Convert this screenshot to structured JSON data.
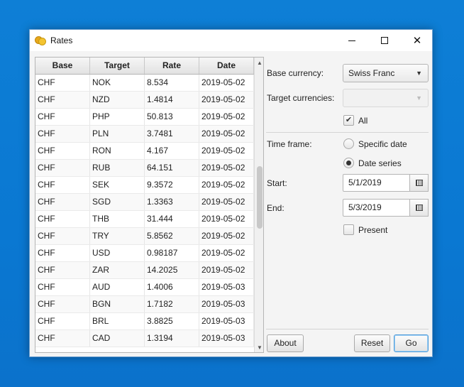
{
  "window": {
    "title": "Rates",
    "icon": "coins-icon"
  },
  "table": {
    "headers": [
      "Base",
      "Target",
      "Rate",
      "Date"
    ],
    "rows": [
      [
        "CHF",
        "NOK",
        "8.534",
        "2019-05-02"
      ],
      [
        "CHF",
        "NZD",
        "1.4814",
        "2019-05-02"
      ],
      [
        "CHF",
        "PHP",
        "50.813",
        "2019-05-02"
      ],
      [
        "CHF",
        "PLN",
        "3.7481",
        "2019-05-02"
      ],
      [
        "CHF",
        "RON",
        "4.167",
        "2019-05-02"
      ],
      [
        "CHF",
        "RUB",
        "64.151",
        "2019-05-02"
      ],
      [
        "CHF",
        "SEK",
        "9.3572",
        "2019-05-02"
      ],
      [
        "CHF",
        "SGD",
        "1.3363",
        "2019-05-02"
      ],
      [
        "CHF",
        "THB",
        "31.444",
        "2019-05-02"
      ],
      [
        "CHF",
        "TRY",
        "5.8562",
        "2019-05-02"
      ],
      [
        "CHF",
        "USD",
        "0.98187",
        "2019-05-02"
      ],
      [
        "CHF",
        "ZAR",
        "14.2025",
        "2019-05-02"
      ],
      [
        "CHF",
        "AUD",
        "1.4006",
        "2019-05-03"
      ],
      [
        "CHF",
        "BGN",
        "1.7182",
        "2019-05-03"
      ],
      [
        "CHF",
        "BRL",
        "3.8825",
        "2019-05-03"
      ],
      [
        "CHF",
        "CAD",
        "1.3194",
        "2019-05-03"
      ]
    ]
  },
  "form": {
    "base_currency_label": "Base currency:",
    "base_currency_value": "Swiss Franc",
    "target_currencies_label": "Target currencies:",
    "target_currencies_value": "",
    "all_label": "All",
    "all_checked": true,
    "time_frame_label": "Time frame:",
    "specific_date_label": "Specific date",
    "date_series_label": "Date series",
    "time_frame_selected": "Date series",
    "start_label": "Start:",
    "start_value": "5/1/2019",
    "end_label": "End:",
    "end_value": "5/3/2019",
    "present_label": "Present",
    "present_checked": false
  },
  "buttons": {
    "about": "About",
    "reset": "Reset",
    "go": "Go"
  }
}
